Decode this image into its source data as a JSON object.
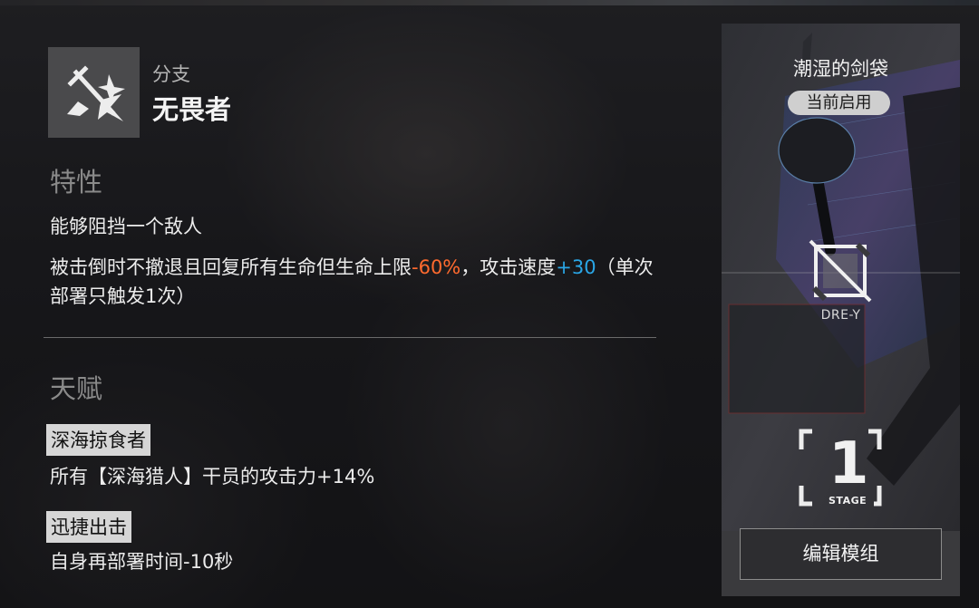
{
  "branch": {
    "label": "分支",
    "name": "无畏者",
    "icon": "branch-swords-icon"
  },
  "trait": {
    "title": "特性",
    "line1": "能够阻挡一个敌人",
    "line2_part1": "被击倒时不撤退且回复所有生命但生命上限",
    "line2_neg": "-60%",
    "line2_part2": "，攻击速度",
    "line2_pos": "+30",
    "line2_part3": "（单次部署只触发1次）"
  },
  "talent": {
    "title": "天赋",
    "items": [
      {
        "name": "深海掠食者",
        "desc": "所有【深海猎人】干员的攻击力+14%"
      },
      {
        "name": "迅捷出击",
        "desc": "自身再部署时间-10秒"
      }
    ]
  },
  "module": {
    "name": "潮湿的剑袋",
    "status": "当前启用",
    "code": "DRE-Y",
    "stage_number": "1",
    "stage_label": "STAGE",
    "edit_label": "编辑模组",
    "icon": "module-type-icon"
  },
  "colors": {
    "negative": "#ff6a2e",
    "positive": "#2aa6e6"
  }
}
